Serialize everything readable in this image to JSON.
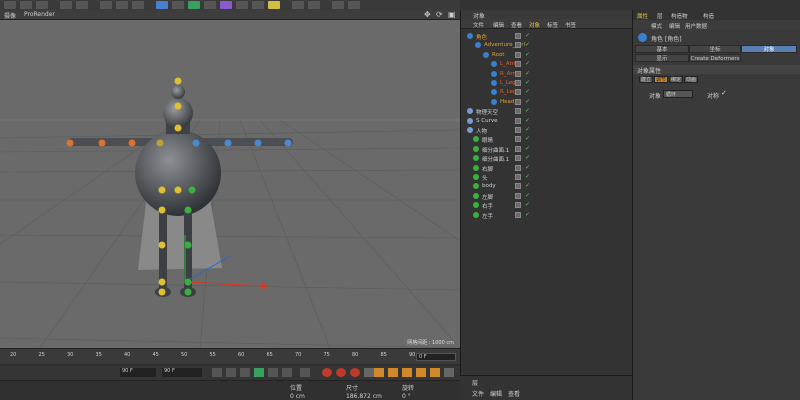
{
  "viewport_menu": {
    "item1": "摄像",
    "item2": "ProRender"
  },
  "viewport": {
    "grid_label": "网格间距 : 1000 cm"
  },
  "timeline": {
    "ticks": [
      "20",
      "25",
      "30",
      "35",
      "40",
      "45",
      "50",
      "55",
      "60",
      "65",
      "70",
      "75",
      "80",
      "85",
      "90"
    ],
    "frame_value": "0 F",
    "start_field": "90 F",
    "end_field": "90 F"
  },
  "bottom": {
    "pos_label": "位置",
    "size_label": "尺寸",
    "rot_label": "旋转",
    "pos_value": "0 cm",
    "size_value": "186.872 cm",
    "rot_value": "0 °"
  },
  "obj_panel": {
    "title": "对象",
    "menu": [
      "文件",
      "编辑",
      "查看",
      "对象",
      "标签",
      "书签"
    ],
    "rows": [
      {
        "label": "角色",
        "color": "#e0a030"
      },
      {
        "label": "Adventure_Ctrl",
        "color": "#e0a030"
      },
      {
        "label": "Root",
        "color": "#e0a030"
      },
      {
        "label": "L_Arm",
        "color": "#e06030"
      },
      {
        "label": "R_Arm",
        "color": "#e06030"
      },
      {
        "label": "L_Leg",
        "color": "#e06030"
      },
      {
        "label": "R_Leg",
        "color": "#e06030"
      },
      {
        "label": "Head",
        "color": "#e0a030"
      },
      {
        "label": "物理天空",
        "color": "#cfcfcf"
      },
      {
        "label": "S Curve",
        "color": "#cfcfcf"
      },
      {
        "label": "人物",
        "color": "#cfcfcf"
      },
      {
        "label": "眼睛",
        "color": "#cfcfcf"
      },
      {
        "label": "细分曲面.1",
        "color": "#cfcfcf"
      },
      {
        "label": "细分曲面.1",
        "color": "#cfcfcf"
      },
      {
        "label": "右脚",
        "color": "#cfcfcf"
      },
      {
        "label": "头",
        "color": "#cfcfcf"
      },
      {
        "label": "body",
        "color": "#cfcfcf"
      },
      {
        "label": "左脚",
        "color": "#cfcfcf"
      },
      {
        "label": "右手",
        "color": "#cfcfcf"
      },
      {
        "label": "左手",
        "color": "#cfcfcf"
      }
    ]
  },
  "attr_panel": {
    "tabs": [
      "属性",
      "层",
      "构造物",
      "构造"
    ],
    "menu": [
      "模式",
      "编辑",
      "用户数据"
    ],
    "object_title": "角色 [角色]",
    "tab_row1": [
      "基本",
      "坐标",
      "对象"
    ],
    "tab_row2": [
      "显示",
      "Create Deformers"
    ],
    "section": "对象属性",
    "pills": [
      "建立",
      "调节",
      "绑定",
      "动画"
    ],
    "field_label": "对象",
    "field_value": "循环",
    "check_label": "对称"
  },
  "layer_panel": {
    "title": "层",
    "menu": [
      "文件",
      "编辑",
      "查看"
    ]
  }
}
